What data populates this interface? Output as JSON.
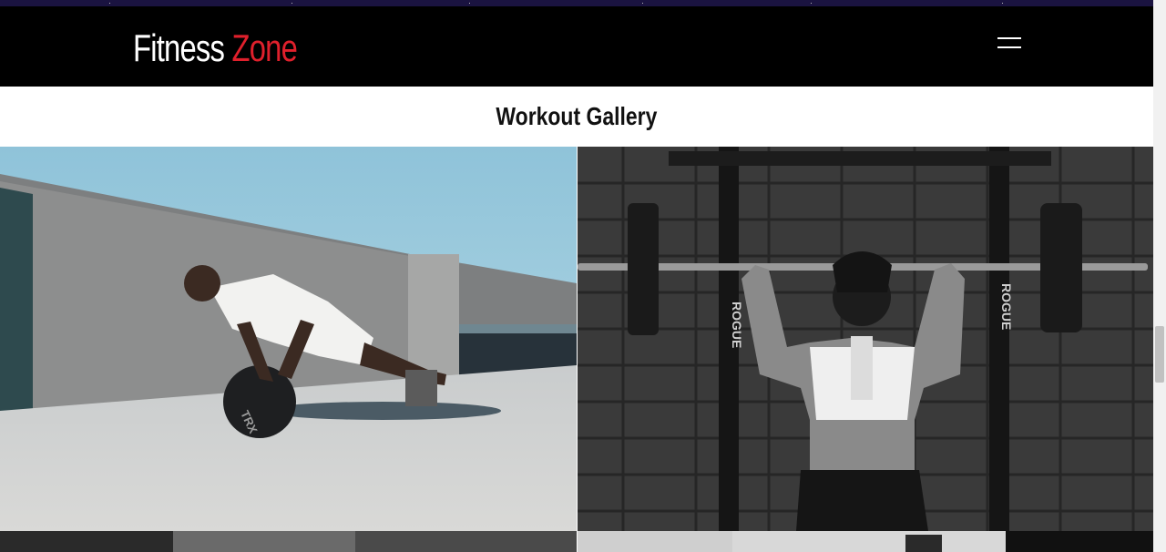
{
  "brand": {
    "word1": "Fitness",
    "word2": "Zone",
    "accent_color": "#e0202c"
  },
  "nav": {
    "menu_icon": "hamburger-menu-icon"
  },
  "gallery": {
    "title": "Workout Gallery",
    "images": [
      {
        "name": "man-pushup-medicine-ball",
        "ball_text": "TRX"
      },
      {
        "name": "woman-overhead-barbell-bw",
        "rack_text_left": "ROGUE",
        "rack_text_right": "ROGUE"
      },
      {
        "name": "gallery-image-3"
      },
      {
        "name": "gallery-image-4"
      }
    ]
  }
}
